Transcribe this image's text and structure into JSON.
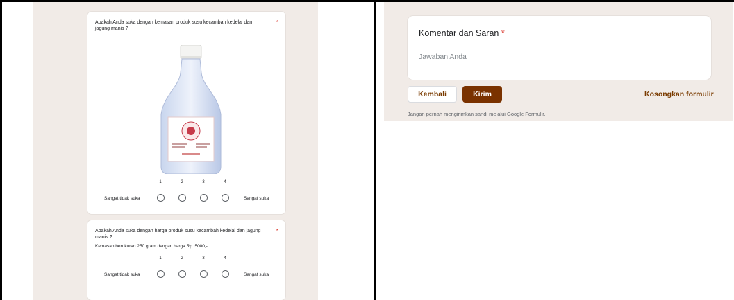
{
  "left_panel": {
    "question1": {
      "text": "Apakah Anda suka dengan kemasan produk susu kecambah kedelai dan jagung manis ?",
      "required_mark": "*",
      "scale_numbers": [
        "1",
        "2",
        "3",
        "4"
      ],
      "low_label": "Sangat tidak suka",
      "high_label": "Sangat suka"
    },
    "question2": {
      "text": "Apakah Anda suka dengan harga produk susu kecambah kedelai dan jagung manis ?",
      "required_mark": "*",
      "subtitle": "Kemasan berukuran 250 gram dengan harga Rp. 5000,-",
      "scale_numbers": [
        "1",
        "2",
        "3",
        "4"
      ],
      "low_label": "Sangat tidak suka",
      "high_label": "Sangat suka"
    }
  },
  "right_panel": {
    "comment_card": {
      "title": "Komentar dan Saran",
      "required_mark": "*",
      "placeholder": "Jawaban Anda"
    },
    "back_button": "Kembali",
    "submit_button": "Kirim",
    "clear_link": "Kosongkan formulir",
    "footer_note": "Jangan pernah mengirimkan sandi melalui Google Formulir."
  },
  "colors": {
    "page_bg": "#f1ebe7",
    "accent": "#7a3200",
    "required": "#d93025"
  }
}
